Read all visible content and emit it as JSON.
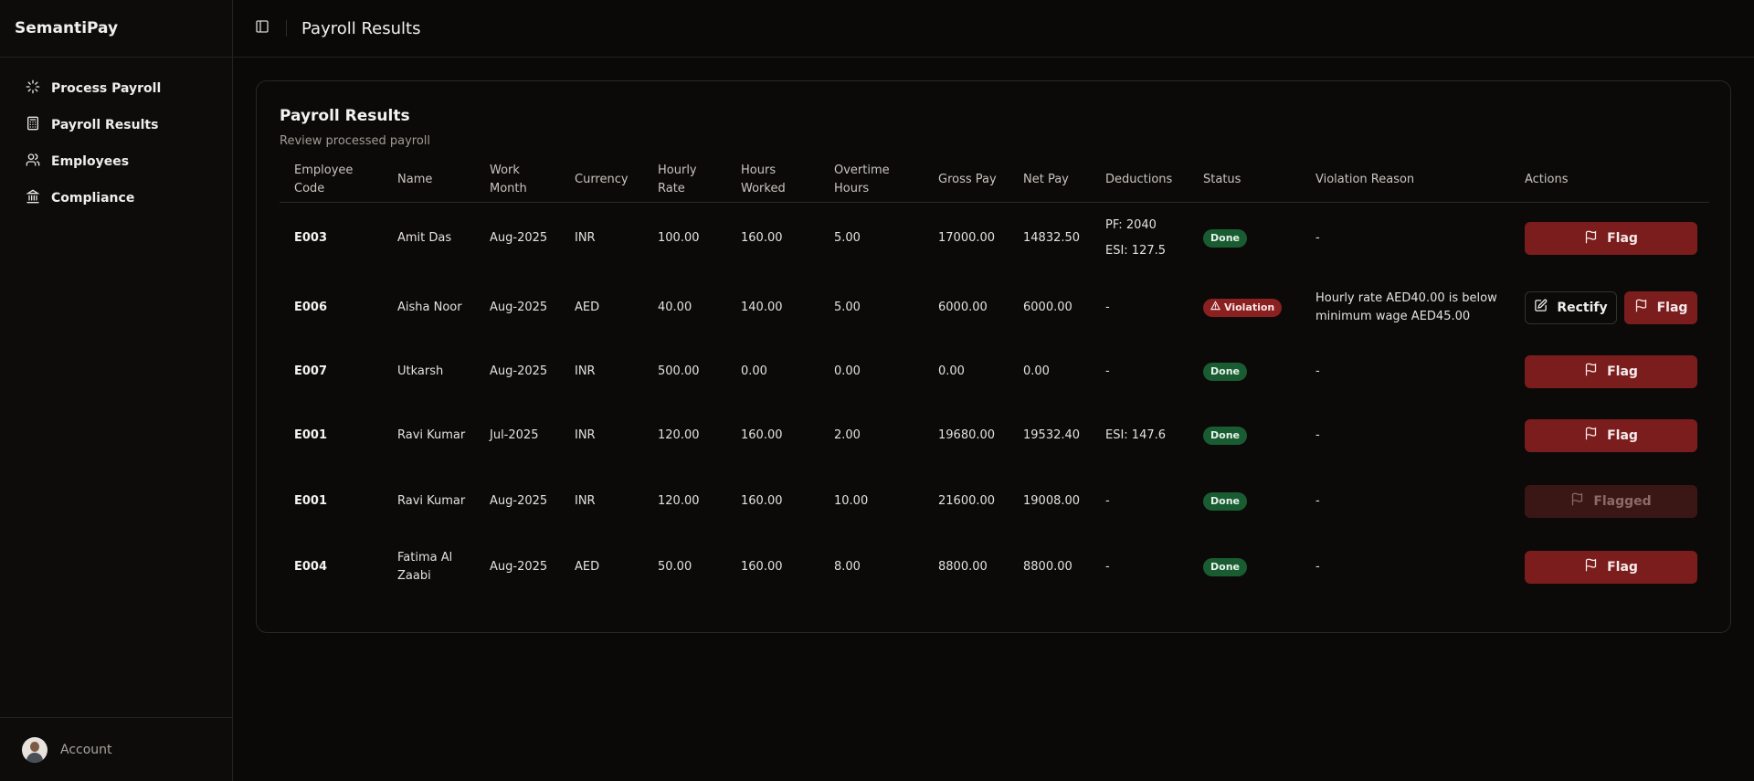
{
  "app": {
    "name": "SemantiPay"
  },
  "sidebar": {
    "items": [
      {
        "label": "Process Payroll",
        "icon": "loader-icon"
      },
      {
        "label": "Payroll Results",
        "icon": "calculator-icon"
      },
      {
        "label": "Employees",
        "icon": "users-icon"
      },
      {
        "label": "Compliance",
        "icon": "landmark-icon"
      }
    ],
    "account_label": "Account"
  },
  "topbar": {
    "title": "Payroll Results"
  },
  "card": {
    "title": "Payroll Results",
    "description": "Review processed payroll"
  },
  "table": {
    "headers": {
      "employee_code": "Employee Code",
      "name": "Name",
      "work_month": "Work Month",
      "currency": "Currency",
      "hourly_rate": "Hourly Rate",
      "hours_worked": "Hours Worked",
      "overtime_hours": "Overtime Hours",
      "gross_pay": "Gross Pay",
      "net_pay": "Net Pay",
      "deductions": "Deductions",
      "status": "Status",
      "violation_reason": "Violation Reason",
      "actions": "Actions"
    },
    "rows": [
      {
        "code": "E003",
        "name": "Amit Das",
        "month": "Aug-2025",
        "currency": "INR",
        "rate": "100.00",
        "hours": "160.00",
        "overtime": "5.00",
        "gross": "17000.00",
        "net": "14832.50",
        "deduction_1": "PF: 2040",
        "deduction_2": "ESI: 127.5",
        "status": "Done",
        "reason": "-",
        "flag_label": "Flag"
      },
      {
        "code": "E006",
        "name": "Aisha Noor",
        "month": "Aug-2025",
        "currency": "AED",
        "rate": "40.00",
        "hours": "140.00",
        "overtime": "5.00",
        "gross": "6000.00",
        "net": "6000.00",
        "deduction_1": "-",
        "deduction_2": "",
        "status": "Violation",
        "reason": "Hourly rate AED40.00 is below minimum wage AED45.00",
        "rectify_label": "Rectify",
        "flag_label": "Flag"
      },
      {
        "code": "E007",
        "name": "Utkarsh",
        "month": "Aug-2025",
        "currency": "INR",
        "rate": "500.00",
        "hours": "0.00",
        "overtime": "0.00",
        "gross": "0.00",
        "net": "0.00",
        "deduction_1": "-",
        "deduction_2": "",
        "status": "Done",
        "reason": "-",
        "flag_label": "Flag"
      },
      {
        "code": "E001",
        "name": "Ravi Kumar",
        "month": "Jul-2025",
        "currency": "INR",
        "rate": "120.00",
        "hours": "160.00",
        "overtime": "2.00",
        "gross": "19680.00",
        "net": "19532.40",
        "deduction_1": "ESI: 147.6",
        "deduction_2": "",
        "status": "Done",
        "reason": "-",
        "flag_label": "Flag"
      },
      {
        "code": "E001",
        "name": "Ravi Kumar",
        "month": "Aug-2025",
        "currency": "INR",
        "rate": "120.00",
        "hours": "160.00",
        "overtime": "10.00",
        "gross": "21600.00",
        "net": "19008.00",
        "deduction_1": "-",
        "deduction_2": "",
        "status": "Done",
        "reason": "-",
        "flag_label": "Flagged"
      },
      {
        "code": "E004",
        "name": "Fatima Al Zaabi",
        "month": "Aug-2025",
        "currency": "AED",
        "rate": "50.00",
        "hours": "160.00",
        "overtime": "8.00",
        "gross": "8800.00",
        "net": "8800.00",
        "deduction_1": "-",
        "deduction_2": "",
        "status": "Done",
        "reason": "-",
        "flag_label": "Flag"
      }
    ]
  },
  "colors": {
    "background": "#0a0908",
    "done_badge": "#1a5c32",
    "violation_badge": "#8a2020",
    "flag_button": "#7c1d1d",
    "flagged_button": "#3a1615"
  }
}
